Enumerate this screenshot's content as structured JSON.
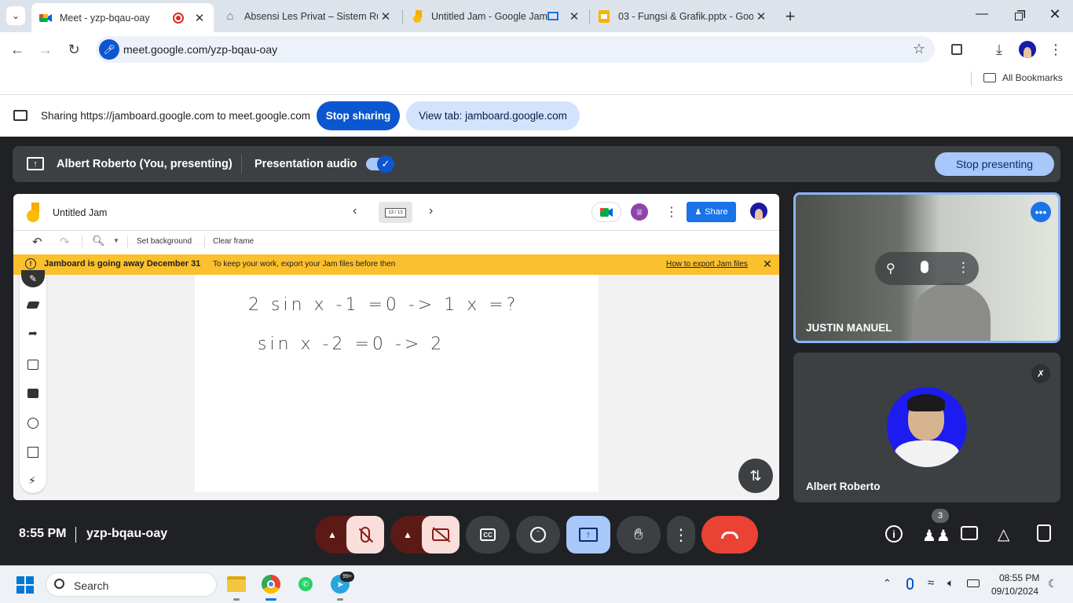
{
  "browser": {
    "tabs": [
      {
        "title": "Meet - yzp-bqau-oay",
        "icon": "meet-icon",
        "active": true
      },
      {
        "title": "Absensi Les Privat – Sistem Rua",
        "icon": "home-icon",
        "active": false
      },
      {
        "title": "Untitled Jam - Google Jamb",
        "icon": "jamboard-icon",
        "active": false
      },
      {
        "title": "03 - Fungsi & Grafik.pptx - Goo",
        "icon": "slides-icon",
        "active": false
      }
    ],
    "url": "meet.google.com/yzp-bqau-oay",
    "bookmarks_label": "All Bookmarks"
  },
  "sharebar": {
    "message": "Sharing https://jamboard.google.com to meet.google.com",
    "stop_sharing": "Stop sharing",
    "view_tab": "View tab: jamboard.google.com"
  },
  "presenting": {
    "presenter_label": "Albert Roberto (You, presenting)",
    "audio_label": "Presentation audio",
    "stop_presenting": "Stop presenting"
  },
  "jamboard": {
    "title": "Untitled Jam",
    "frame_counter": "13 / 13",
    "share_label": "Share",
    "set_background": "Set background",
    "clear_frame": "Clear frame",
    "banner_title": "Jamboard is going away December 31",
    "banner_text": "To keep your work, export your Jam files before then",
    "banner_link": "How to export Jam files"
  },
  "handwriting": {
    "line1": "2 sin x -1 =0 -> 1   x =?",
    "line2": "sin x -2 =0 -> 2"
  },
  "participants": [
    {
      "name": "JUSTIN MANUEL"
    },
    {
      "name": "Albert Roberto"
    }
  ],
  "meeting": {
    "time": "8:55 PM",
    "code": "yzp-bqau-oay",
    "people_count": "3"
  },
  "taskbar": {
    "search_placeholder": "Search",
    "clock_time": "08:55 PM",
    "clock_date": "09/10/2024",
    "telegram_badge": "99+"
  },
  "colors": {
    "meet_bg": "#202124",
    "accent_blue": "#0b57d0",
    "light_blue": "#a8c7fa",
    "end_call_red": "#ea4335",
    "muted_red": "#f9dedc",
    "jam_banner": "#fbc02d"
  }
}
